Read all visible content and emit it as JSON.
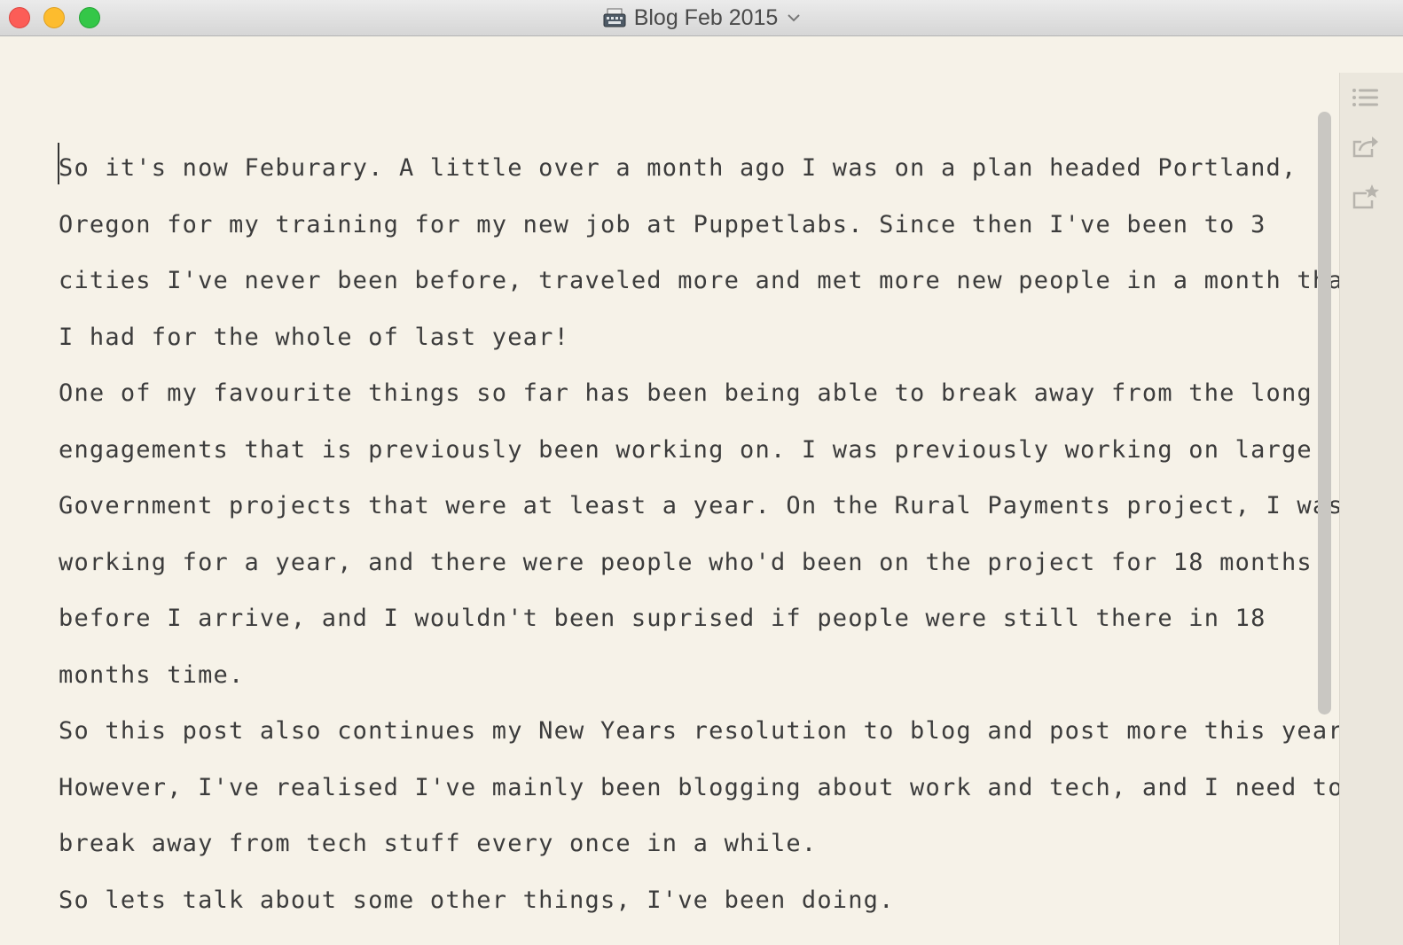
{
  "window": {
    "title": "Blog Feb 2015",
    "title_icon": "typewriter-icon",
    "title_menu_icon": "chevron-down-icon",
    "controls": [
      "close",
      "minimize",
      "zoom"
    ]
  },
  "editor": {
    "lines": [
      "So it's now Feburary. A little over a month ago I was on a plan headed Portland,",
      "Oregon for my training for my new job at Puppetlabs. Since then I've been to 3",
      "cities I've never been before, traveled more and met more new people in a month than",
      "I had for the whole of last year!",
      "One of my favourite things so far has been being able to break away from the long",
      "engagements that is previously been working on. I was previously working on large",
      "Government projects that were at least a year. On the Rural Payments project, I was",
      "working for a year, and there were people who'd been on the project for 18 months",
      "before I arrive, and I wouldn't been suprised if people were still there in 18",
      "months time.",
      "So this post also continues my New Years resolution to blog and post more this year.",
      "However, I've realised I've mainly been blogging about work and tech, and I need to",
      "break away from tech stuff every once in a while.",
      "So lets talk about some other things, I've been doing."
    ]
  },
  "sidebar": {
    "icons": [
      "list-icon",
      "share-icon",
      "bookmark-star-icon"
    ]
  },
  "colors": {
    "background": "#f6f2e8",
    "text": "#3c3c3c",
    "sidebar": "#ebe7dd",
    "icon": "#b7b4ad"
  }
}
